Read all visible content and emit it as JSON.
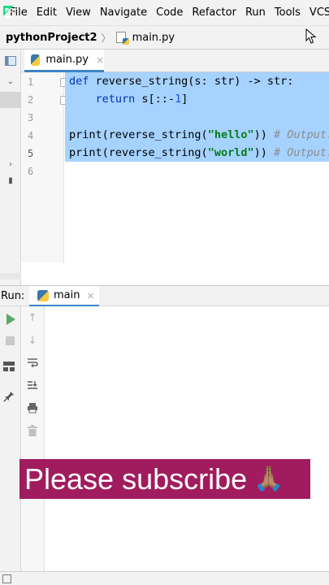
{
  "app": {
    "logo_text": "PC",
    "menu": [
      "File",
      "Edit",
      "View",
      "Navigate",
      "Code",
      "Refactor",
      "Run",
      "Tools",
      "VCS"
    ]
  },
  "navbar": {
    "project": "pythonProject2",
    "file": "main.py"
  },
  "editor": {
    "tab_label": "main.py",
    "tab_close": "×",
    "line_numbers": [
      "1",
      "2",
      "3",
      "4",
      "5",
      "6"
    ],
    "lines": {
      "l1_kw": "def",
      "l1_rest": " reverse_string(s: str) -> str:",
      "l2_kw": "    return",
      "l2_a": " s[::-",
      "l2_num": "1",
      "l2_b": "]",
      "l4_a": "print(reverse_string(",
      "l4_str": "\"hello\"",
      "l4_b": ")) ",
      "l4_cmt": "# Output: olleh",
      "l5_a": "print(reverse_string(",
      "l5_str": "\"world\"",
      "l5_b": ")) ",
      "l5_cmt": "# Output: dlrow"
    }
  },
  "run_panel": {
    "label": "Run:",
    "tab_label": "main",
    "tab_close": "×"
  },
  "banner": {
    "text": "Please subscribe",
    "emoji": "🙏🏽"
  },
  "colors": {
    "selection": "#a6d2ff",
    "keyword": "#0033b3",
    "string": "#067d17",
    "number": "#1750eb",
    "comment": "#8c8c8c",
    "banner_bg": "#a01c5e",
    "run_green": "#59a869"
  },
  "icons": [
    "pycharm-logo-icon",
    "mouse-cursor-icon",
    "python-file-icon",
    "run-icon",
    "stop-icon",
    "arrow-up-icon",
    "arrow-down-icon",
    "soft-wrap-icon",
    "scroll-to-end-icon",
    "print-icon",
    "trash-icon",
    "layout-icon",
    "pin-icon"
  ]
}
